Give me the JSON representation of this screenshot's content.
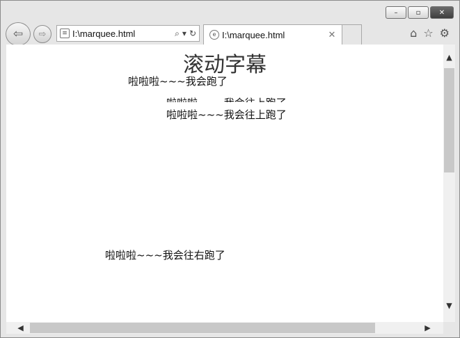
{
  "browser": {
    "address": "I:\\marquee.html",
    "tab_title": "I:\\marquee.html",
    "caption": {
      "minimize": "–",
      "maximize": "▫",
      "close": "✕"
    },
    "icons": {
      "back": "arrow-left-icon",
      "forward": "arrow-right-icon",
      "search": "search-icon",
      "refresh": "refresh-icon",
      "home": "home-icon",
      "favorites": "star-icon",
      "settings": "gear-icon"
    }
  },
  "page": {
    "heading": "滚动字幕",
    "marquee": [
      "啦啦啦~~~我会跑了",
      "啦啦啦~~~我会往上跑了",
      "啦啦啦~~~我会往上跑了",
      "啦啦啦~~~我会往右跑了"
    ]
  }
}
